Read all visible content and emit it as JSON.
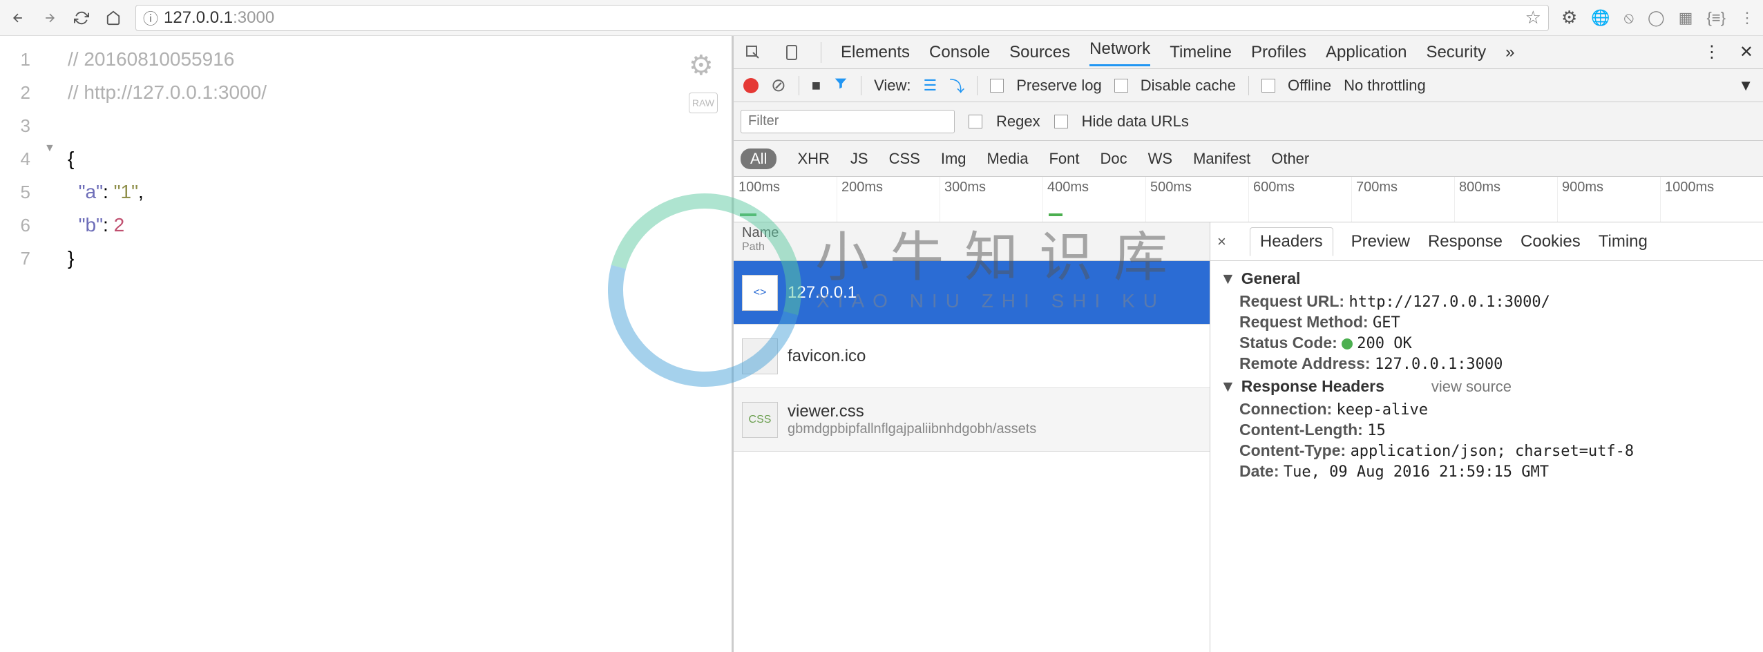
{
  "browser": {
    "url_host": "127.0.0.1",
    "url_port": ":3000"
  },
  "editor": {
    "lines": [
      "1",
      "2",
      "3",
      "4",
      "5",
      "6",
      "7"
    ],
    "c1": "// 20160810055916",
    "c2": "// http://127.0.0.1:3000/",
    "brace_open": "{",
    "k_a": "\"a\"",
    "v_a": "\"1\"",
    "k_b": "\"b\"",
    "v_b": "2",
    "brace_close": "}"
  },
  "devtools": {
    "tabs": [
      "Elements",
      "Console",
      "Sources",
      "Network",
      "Timeline",
      "Profiles",
      "Application",
      "Security"
    ],
    "view_label": "View:",
    "preserve": "Preserve log",
    "disable_cache": "Disable cache",
    "offline": "Offline",
    "throttle": "No throttling",
    "filter_ph": "Filter",
    "regex": "Regex",
    "hide_urls": "Hide data URLs",
    "type_filters": [
      "All",
      "XHR",
      "JS",
      "CSS",
      "Img",
      "Media",
      "Font",
      "Doc",
      "WS",
      "Manifest",
      "Other"
    ],
    "timeline_ticks": [
      "100ms",
      "200ms",
      "300ms",
      "400ms",
      "500ms",
      "600ms",
      "700ms",
      "800ms",
      "900ms",
      "1000ms"
    ],
    "req_header_name": "Name",
    "req_header_path": "Path",
    "requests": [
      {
        "name": "127.0.0.1",
        "path": "",
        "icon": "<>",
        "selected": true
      },
      {
        "name": "favicon.ico",
        "path": "",
        "icon": "",
        "selected": false
      },
      {
        "name": "viewer.css",
        "path": "gbmdgpbipfallnflgajpaliibnhdgobh/assets",
        "icon": "CSS",
        "selected": false
      }
    ],
    "detail_tabs": [
      "Headers",
      "Preview",
      "Response",
      "Cookies",
      "Timing"
    ],
    "general": {
      "title": "General",
      "url_l": "Request URL:",
      "url_v": "http://127.0.0.1:3000/",
      "method_l": "Request Method:",
      "method_v": "GET",
      "status_l": "Status Code:",
      "status_v": "200 OK",
      "remote_l": "Remote Address:",
      "remote_v": "127.0.0.1:3000"
    },
    "resp_headers": {
      "title": "Response Headers",
      "view_source": "view source",
      "conn_l": "Connection:",
      "conn_v": "keep-alive",
      "len_l": "Content-Length:",
      "len_v": "15",
      "type_l": "Content-Type:",
      "type_v": "application/json; charset=utf-8",
      "date_l": "Date:",
      "date_v": "Tue, 09 Aug 2016 21:59:15 GMT"
    }
  },
  "watermark": {
    "main": "小牛知识库",
    "sub": "XIAO NIU ZHI SHI KU"
  }
}
